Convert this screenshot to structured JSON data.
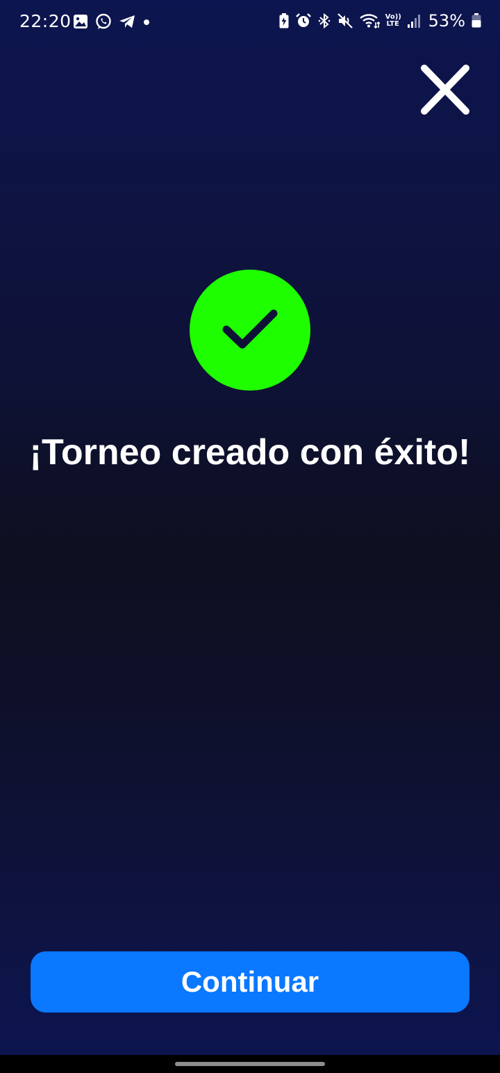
{
  "status_bar": {
    "time": "22:20",
    "left_icons": [
      "image-icon",
      "whatsapp-icon",
      "telegram-icon",
      "dot-icon"
    ],
    "right_icons": [
      "battery-saver-icon",
      "alarm-icon",
      "bluetooth-icon",
      "mute-icon",
      "wifi-icon",
      "volte-icon",
      "signal-icon",
      "battery-icon"
    ],
    "volte_top": "Vo))",
    "volte_bottom": "LTE",
    "battery_percent": "53%",
    "battery_level": 0.53
  },
  "close_icon": "close-icon",
  "success_icon": "checkmark-icon",
  "message": {
    "title": "¡Torneo creado con éxito!"
  },
  "continue_button": {
    "label": "Continuar"
  },
  "colors": {
    "success_green": "#1ffe00",
    "button_blue": "#0a78ff",
    "background_dark": "#0e0f1f",
    "background_navy": "#0d1550",
    "text_white": "#ffffff"
  }
}
